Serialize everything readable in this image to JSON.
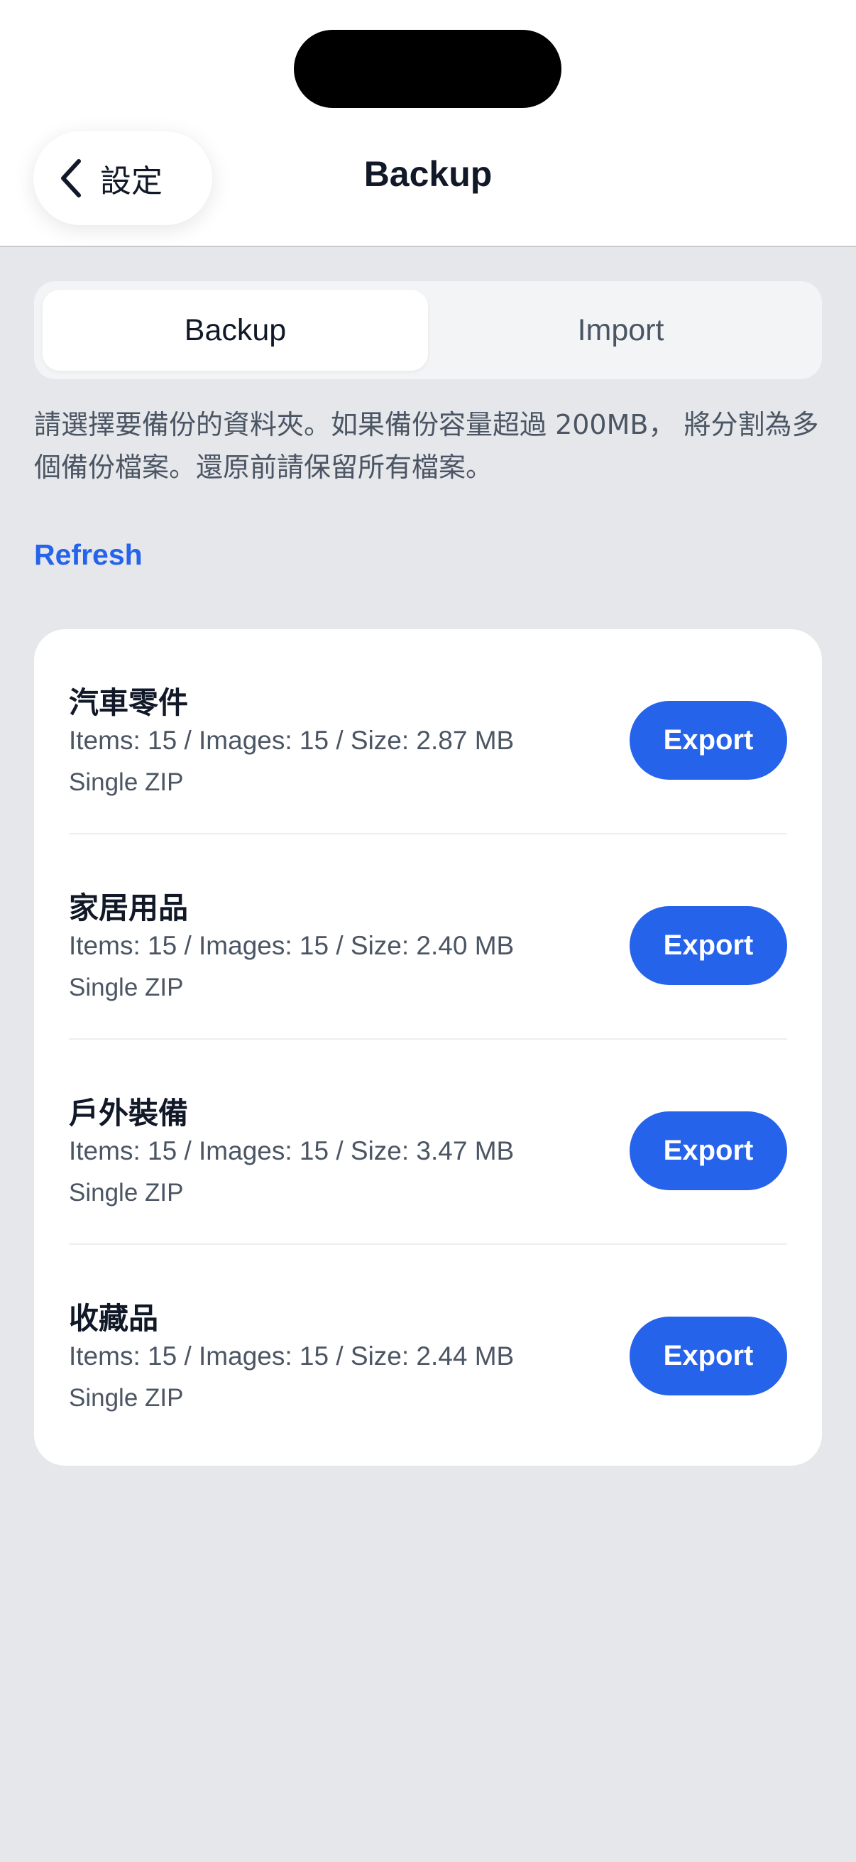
{
  "nav": {
    "back_label": "設定",
    "title": "Backup"
  },
  "tabs": [
    {
      "label": "Backup",
      "active": true
    },
    {
      "label": "Import",
      "active": false
    }
  ],
  "description": "請選擇要備份的資料夾。如果備份容量超過 200MB， 將分割為多個備份檔案。還原前請保留所有檔案。",
  "refresh_label": "Refresh",
  "folders": [
    {
      "name": "汽車零件",
      "stats": "Items: 15 / Images: 15 / Size: 2.87 MB",
      "type": "Single ZIP",
      "action": "Export"
    },
    {
      "name": "家居用品",
      "stats": "Items: 15 / Images: 15 / Size: 2.40 MB",
      "type": "Single ZIP",
      "action": "Export"
    },
    {
      "name": "戶外裝備",
      "stats": "Items: 15 / Images: 15 / Size: 3.47 MB",
      "type": "Single ZIP",
      "action": "Export"
    },
    {
      "name": "收藏品",
      "stats": "Items: 15 / Images: 15 / Size: 2.44 MB",
      "type": "Single ZIP",
      "action": "Export"
    }
  ],
  "colors": {
    "accent": "#2563eb",
    "background": "#e5e7eb",
    "card": "#ffffff"
  },
  "icons": {
    "back": "chevron-left-icon"
  }
}
